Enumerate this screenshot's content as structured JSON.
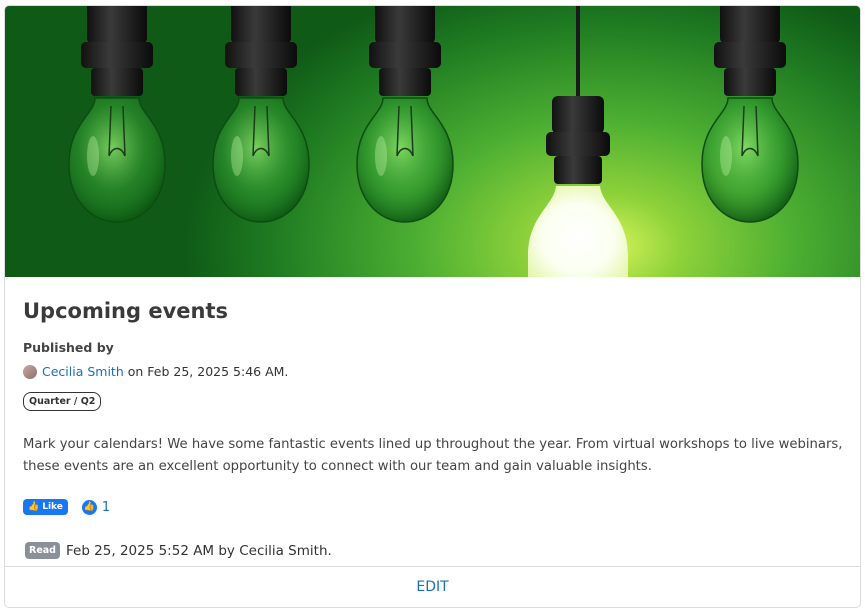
{
  "post": {
    "title": "Upcoming events",
    "published_by_label": "Published by",
    "author": "Cecilia Smith",
    "published_suffix": "on Feb 25, 2025 5:46 AM.",
    "tag": "Quarter / Q2",
    "description": "Mark your calendars! We have some fantastic events lined up throughout the year. From virtual workshops to live webinars, these events are an excellent opportunity to connect with our team and gain valuable insights.",
    "like_label": "Like",
    "like_count": "1",
    "read_badge": "Read",
    "read_text": "Feb 25, 2025 5:52 AM by Cecilia Smith."
  },
  "footer": {
    "edit_label": "EDIT"
  },
  "colors": {
    "accent": "#1a6fb3",
    "like_blue": "#1877f2",
    "hero_green": "#4caf32"
  },
  "icons": {
    "like": "thumbs-up-icon",
    "avatar": "user-avatar"
  }
}
